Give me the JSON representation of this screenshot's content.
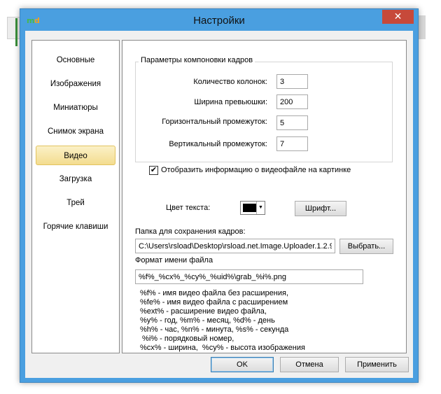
{
  "window": {
    "title": "Настройки",
    "icon_letters": [
      "m",
      "d"
    ],
    "close_glyph": "✕"
  },
  "sidebar": {
    "items": [
      {
        "label": "Основные"
      },
      {
        "label": "Изображения"
      },
      {
        "label": "Миниатюры"
      },
      {
        "label": "Снимок экрана"
      },
      {
        "label": "Видео",
        "active": true
      },
      {
        "label": "Загрузка"
      },
      {
        "label": "Трей"
      },
      {
        "label": "Горячие клавиши"
      }
    ]
  },
  "layout_group": {
    "title": "Параметры компоновки кадров",
    "columns_label": "Количество колонок:",
    "columns_value": "3",
    "thumb_width_label": "Ширина превьюшки:",
    "thumb_width_value": "200",
    "h_gap_label": "Горизонтальный промежуток:",
    "h_gap_value": "5",
    "v_gap_label": "Вертикальный промежуток:",
    "v_gap_value": "7"
  },
  "video_info": {
    "checkbox_label": "Отобразить информацию о видеофайле на картинке",
    "checked": true,
    "check_glyph": "✔",
    "text_color_label": "Цвет текста:",
    "text_color": "#000000",
    "font_button": "Шрифт..."
  },
  "save": {
    "folder_label": "Папка для сохранения кадров:",
    "folder_value": "C:\\Users\\rsload\\Desktop\\rsload.net.Image.Uploader.1.2.9",
    "browse_button": "Выбрать...",
    "filename_label": "Формат имени файла",
    "filename_value": "%f%_%cx%_%cy%_%uid%\\grab_%i%.png"
  },
  "help_lines": [
    "%f% - имя видео файла без расширения,",
    "%fe% - имя видео файла с расширением",
    "%ext% - расширение видео файла,",
    "%y% - год, %m% - месяц, %d% - день",
    "%h% - час, %n% - минута, %s% - секунда",
    " %i% - порядковый номер,",
    "%cx% - ширина,  %cy% - высота изображения"
  ],
  "footer": {
    "ok": "OK",
    "cancel": "Отмена",
    "apply": "Применить"
  },
  "colors": {
    "frame": "#4a9fe0",
    "close": "#c7493a",
    "active_item": "#f3dc8f"
  }
}
